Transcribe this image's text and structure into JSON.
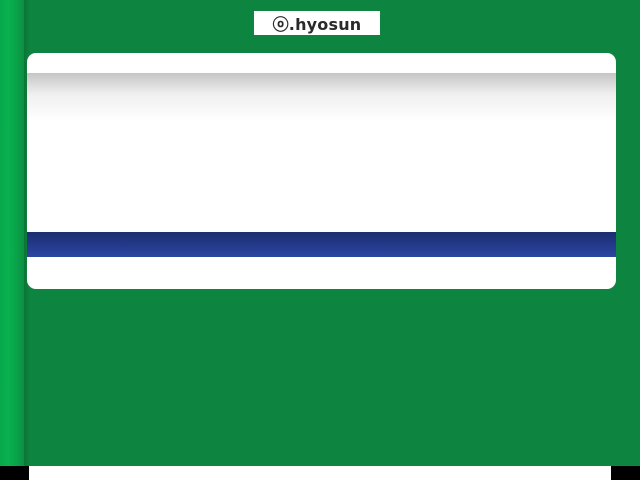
{
  "logo": {
    "text": "ⓞ.hyosun"
  },
  "colors": {
    "background": "#0d843f",
    "left_bar": "#0ab14f",
    "panel": "#ffffff",
    "band": "#24398a",
    "bottom_strip": "#000000"
  }
}
